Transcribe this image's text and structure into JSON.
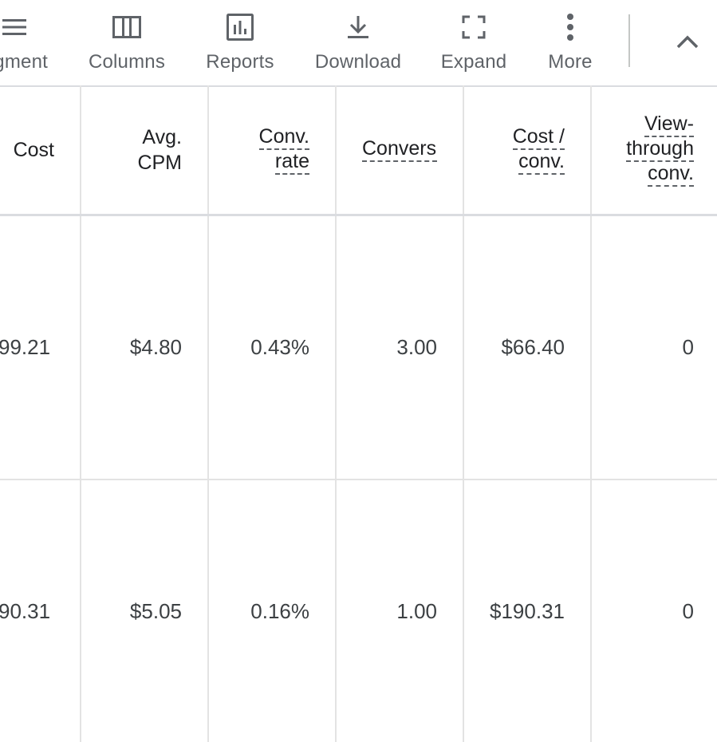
{
  "toolbar": {
    "items": [
      {
        "label": "gment",
        "icon": "segment-icon"
      },
      {
        "label": "Columns",
        "icon": "columns-icon"
      },
      {
        "label": "Reports",
        "icon": "reports-icon"
      },
      {
        "label": "Download",
        "icon": "download-icon"
      },
      {
        "label": "Expand",
        "icon": "expand-icon"
      },
      {
        "label": "More",
        "icon": "more-vert-icon"
      }
    ],
    "collapse_icon": "chevron-up-icon"
  },
  "table": {
    "columns": [
      {
        "line1": "Cost",
        "line2": "",
        "line3": ""
      },
      {
        "line1": "Avg.",
        "line2": "CPM",
        "line3": ""
      },
      {
        "line1": "Conv.",
        "line2": "rate",
        "line3": ""
      },
      {
        "line1": "Convers",
        "line2": "",
        "line3": ""
      },
      {
        "line1": "Cost /",
        "line2": "conv.",
        "line3": ""
      },
      {
        "line1": "View-",
        "line2": "through",
        "line3": "conv."
      }
    ],
    "rows": [
      {
        "cost": "99.21",
        "avg_cpm": "$4.80",
        "conv_rate": "0.43%",
        "conversions": "3.00",
        "cost_per_conv": "$66.40",
        "view_through_conv": "0"
      },
      {
        "cost": "90.31",
        "avg_cpm": "$5.05",
        "conv_rate": "0.16%",
        "conversions": "1.00",
        "cost_per_conv": "$190.31",
        "view_through_conv": "0"
      }
    ]
  },
  "colors": {
    "icon": "#5f6368",
    "text": "#3c4043",
    "header_text": "#202124",
    "grid_line": "#e3e3e3"
  }
}
